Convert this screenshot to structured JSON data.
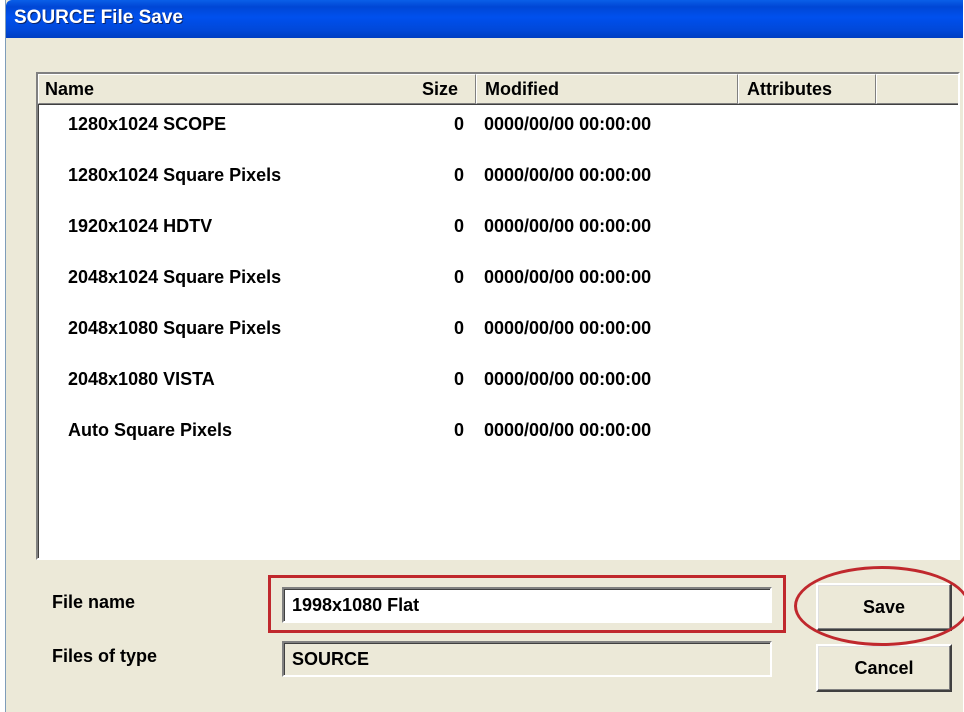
{
  "window": {
    "title": "SOURCE File Save"
  },
  "list": {
    "columns": {
      "name": "Name",
      "size": "Size",
      "modified": "Modified",
      "attributes": "Attributes"
    },
    "rows": [
      {
        "name": "1280x1024 SCOPE",
        "size": "0",
        "modified": "0000/00/00 00:00:00"
      },
      {
        "name": "1280x1024 Square Pixels",
        "size": "0",
        "modified": "0000/00/00 00:00:00"
      },
      {
        "name": "1920x1024 HDTV",
        "size": "0",
        "modified": "0000/00/00 00:00:00"
      },
      {
        "name": "2048x1024 Square Pixels",
        "size": "0",
        "modified": "0000/00/00 00:00:00"
      },
      {
        "name": "2048x1080 Square Pixels",
        "size": "0",
        "modified": "0000/00/00 00:00:00"
      },
      {
        "name": "2048x1080 VISTA",
        "size": "0",
        "modified": "0000/00/00 00:00:00"
      },
      {
        "name": "Auto Square Pixels",
        "size": "0",
        "modified": "0000/00/00 00:00:00"
      }
    ]
  },
  "form": {
    "file_name_label": "File name",
    "file_name_value": "1998x1080 Flat",
    "files_of_type_label": "Files of type",
    "files_of_type_value": "SOURCE"
  },
  "buttons": {
    "save": "Save",
    "cancel": "Cancel"
  },
  "colors": {
    "titlebar": "#0050ee",
    "annotation": "#c0282d",
    "dialog_bg": "#ece9d8"
  }
}
